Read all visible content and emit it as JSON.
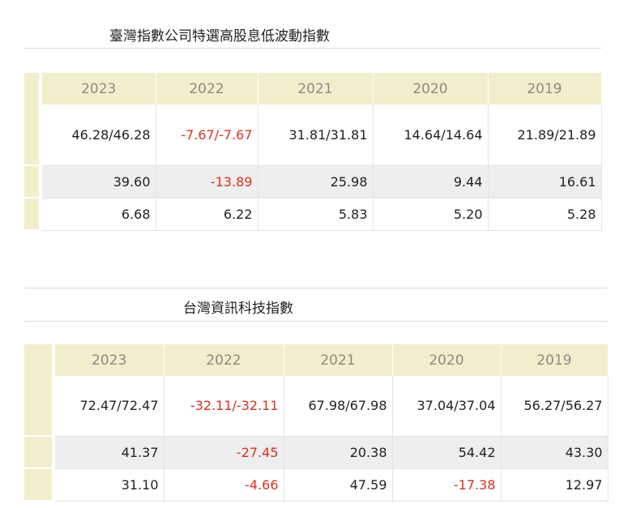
{
  "tables": [
    {
      "title": "臺灣指數公司特選高股息低波動指數",
      "years": [
        "2023",
        "2022",
        "2021",
        "2020",
        "2019"
      ],
      "rows": [
        [
          "46.28/46.28",
          "-7.67/-7.67",
          "31.81/31.81",
          "14.64/14.64",
          "21.89/21.89"
        ],
        [
          "39.60",
          "-13.89",
          "25.98",
          "9.44",
          "16.61"
        ],
        [
          "6.68",
          "6.22",
          "5.83",
          "5.20",
          "5.28"
        ]
      ]
    },
    {
      "title": "台灣資訊科技指數",
      "years": [
        "2023",
        "2022",
        "2021",
        "2020",
        "2019"
      ],
      "rows": [
        [
          "72.47/72.47",
          "-32.11/-32.11",
          "67.98/67.98",
          "37.04/37.04",
          "56.27/56.27"
        ],
        [
          "41.37",
          "-27.45",
          "20.38",
          "54.42",
          "43.30"
        ],
        [
          "31.10",
          "-4.66",
          "47.59",
          "-17.38",
          "12.97"
        ]
      ]
    }
  ],
  "colors": {
    "header_bg": "#f2eecb",
    "negative": "#d93025",
    "row_alt": "#eeeeee"
  }
}
